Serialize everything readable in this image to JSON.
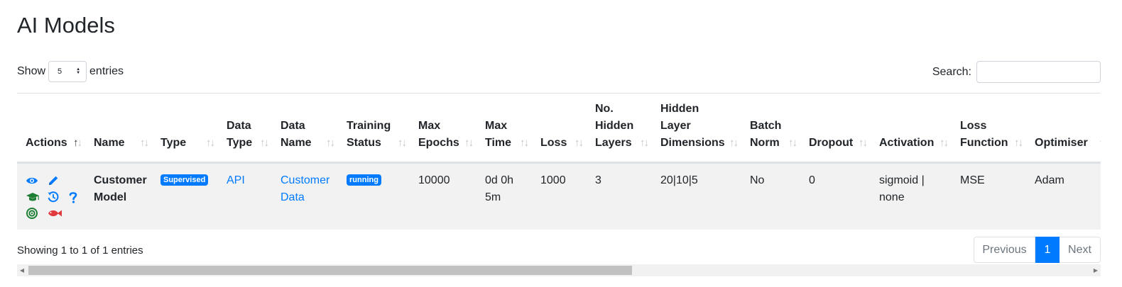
{
  "title": "AI Models",
  "length": {
    "show": "Show",
    "value": "5",
    "entries": "entries"
  },
  "search": {
    "label": "Search:",
    "placeholder": ""
  },
  "sort_glyphs": {
    "up": "↑",
    "down": "↓"
  },
  "columns": [
    {
      "l1": "",
      "l2": "",
      "l3": "Actions"
    },
    {
      "l1": "",
      "l2": "",
      "l3": "Name"
    },
    {
      "l1": "",
      "l2": "",
      "l3": "Type"
    },
    {
      "l1": "",
      "l2": "Data",
      "l3": "Type"
    },
    {
      "l1": "",
      "l2": "Data",
      "l3": "Name"
    },
    {
      "l1": "",
      "l2": "Training",
      "l3": "Status"
    },
    {
      "l1": "",
      "l2": "Max",
      "l3": "Epochs"
    },
    {
      "l1": "",
      "l2": "Max",
      "l3": "Time"
    },
    {
      "l1": "",
      "l2": "",
      "l3": "Loss"
    },
    {
      "l1": "No.",
      "l2": "Hidden",
      "l3": "Layers"
    },
    {
      "l1": "Hidden",
      "l2": "Layer",
      "l3": "Dimensions"
    },
    {
      "l1": "",
      "l2": "Batch",
      "l3": "Norm"
    },
    {
      "l1": "",
      "l2": "",
      "l3": "Dropout"
    },
    {
      "l1": "",
      "l2": "",
      "l3": "Activation"
    },
    {
      "l1": "",
      "l2": "Loss",
      "l3": "Function"
    },
    {
      "l1": "",
      "l2": "",
      "l3": "Optimiser"
    }
  ],
  "rows": [
    {
      "actions": [
        "eye-icon",
        "edit-icon",
        "train-icon",
        "history-icon",
        "help-icon",
        "target-icon",
        "fish-icon"
      ],
      "name": "Customer Model",
      "type": "Supervised",
      "data_type": "API",
      "data_name": "Customer Data",
      "training_status": "running",
      "max_epochs": "10000",
      "max_time": "0d 0h 5m",
      "loss": "1000",
      "hidden_layers": "3",
      "hidden_dims": "20|10|5",
      "batch_norm": "No",
      "dropout": "0",
      "activation": "sigmoid | none",
      "loss_function": "MSE",
      "optimiser": "Adam"
    }
  ],
  "info": "Showing 1 to 1 of 1 entries",
  "pagination": {
    "previous": "Previous",
    "current": "1",
    "next": "Next"
  },
  "colors": {
    "primary": "#007bff",
    "success": "#1e7e34",
    "danger": "#e0393e",
    "row_bg": "#f2f2f2"
  }
}
